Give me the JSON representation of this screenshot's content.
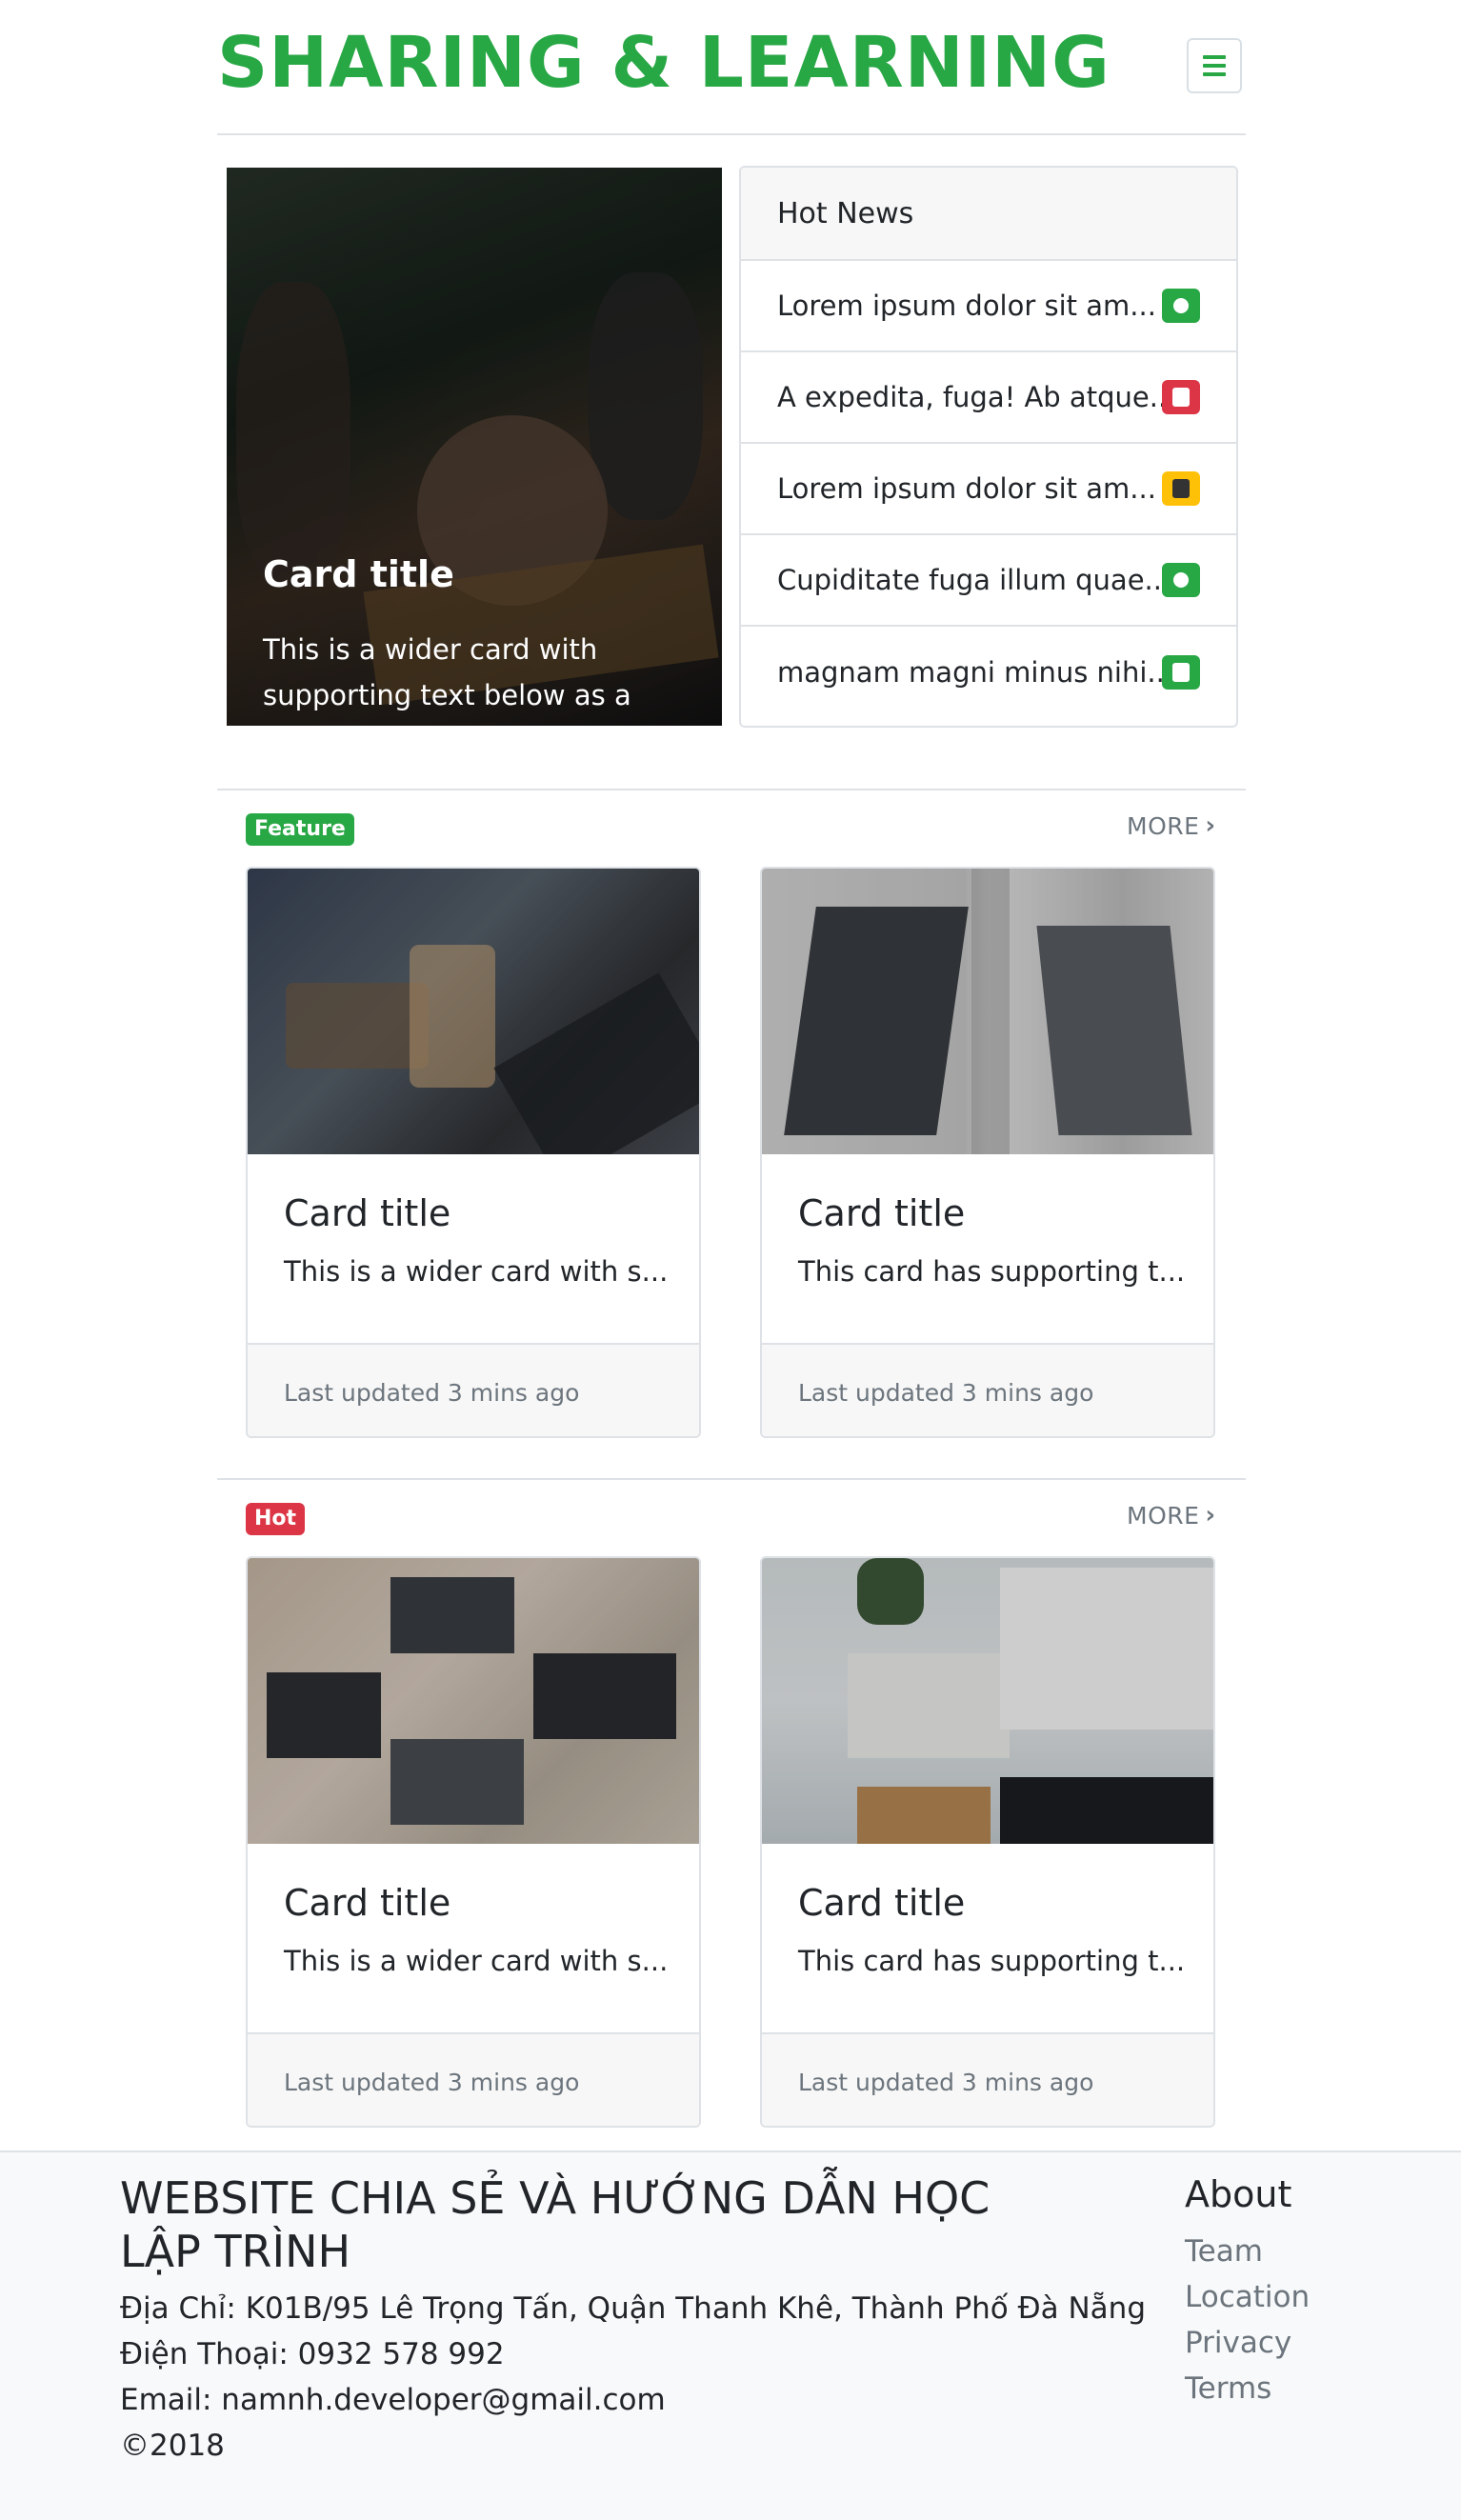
{
  "header": {
    "title": "SHARING & LEARNING",
    "menu_icon": "hamburger-icon"
  },
  "hero": {
    "title": "Card title",
    "text": "This is a wider card with supporting text below as a natural lead-in to additional content. This content is a little bit longer."
  },
  "hot_news": {
    "header": "Hot News",
    "items": [
      {
        "text": "Lorem ipsum dolor sit am...",
        "icon": "nodejs-icon",
        "color": "#28a745"
      },
      {
        "text": "A expedita, fuga! Ab atque...",
        "icon": "html5-icon",
        "color": "#dc3545"
      },
      {
        "text": "Lorem ipsum dolor sit am...",
        "icon": "js-icon",
        "color": "#ffc107"
      },
      {
        "text": "Cupiditate fuga illum quae...",
        "icon": "nodejs-icon",
        "color": "#28a745"
      },
      {
        "text": "magnam magni minus nihi...",
        "icon": "html5-icon",
        "color": "#28a745"
      }
    ]
  },
  "sections": [
    {
      "badge": "Feature",
      "badge_color": "#28a745",
      "more": "MORE",
      "cards": [
        {
          "title": "Card title",
          "text": "This is a wider card with s...",
          "footer": "Last updated 3 mins ago"
        },
        {
          "title": "Card title",
          "text": "This card has supporting t...",
          "footer": "Last updated 3 mins ago"
        }
      ]
    },
    {
      "badge": "Hot",
      "badge_color": "#dc3545",
      "more": "MORE",
      "cards": [
        {
          "title": "Card title",
          "text": "This is a wider card with s...",
          "footer": "Last updated 3 mins ago"
        },
        {
          "title": "Card title",
          "text": "This card has supporting t...",
          "footer": "Last updated 3 mins ago"
        }
      ]
    }
  ],
  "footer": {
    "title": "WEBSITE CHIA SẺ VÀ HƯỚNG DẪN HỌC LẬP TRÌNH",
    "address": "Địa Chỉ: K01B/95 Lê Trọng Tấn, Quận Thanh Khê, Thành Phố Đà Nẵng",
    "phone": "Điện Thoại: 0932 578 992",
    "email": "Email: namnh.developer@gmail.com",
    "copyright": "©2018",
    "about_title": "About",
    "links": [
      "Team",
      "Location",
      "Privacy",
      "Terms"
    ]
  }
}
